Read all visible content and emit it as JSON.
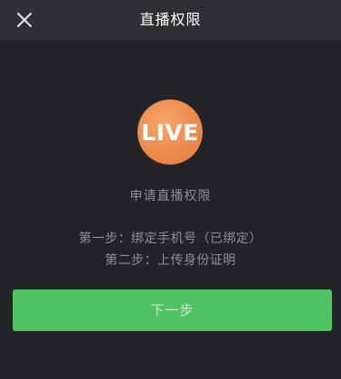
{
  "header": {
    "title": "直播权限",
    "close_icon": "close-icon"
  },
  "badge": {
    "text": "LIVE",
    "color": "#ee8a4d"
  },
  "main": {
    "apply_text": "申请直播权限",
    "steps": [
      "第一步：绑定手机号（已绑定）",
      "第二步：上传身份证明"
    ]
  },
  "footer": {
    "next_label": "下一步",
    "button_color": "#4fc364"
  }
}
